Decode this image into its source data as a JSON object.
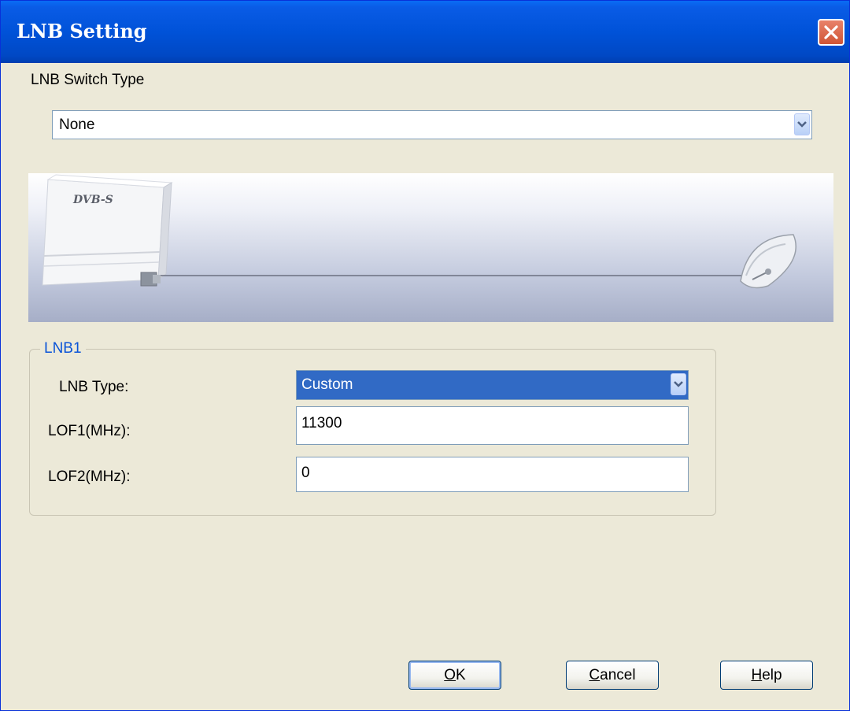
{
  "window": {
    "title": "LNB Setting",
    "close_icon": "close-icon"
  },
  "switch_type": {
    "label": "LNB Switch Type",
    "value": "None"
  },
  "banner": {
    "device_label": "DVB-S",
    "device_icon": "dvb-s-receiver-icon",
    "dish_icon": "satellite-dish-icon"
  },
  "lnb1": {
    "title": "LNB1",
    "type_label": "LNB Type:",
    "type_value": "Custom",
    "lof1_label": "LOF1(MHz):",
    "lof1_value": "11300",
    "lof2_label": "LOF2(MHz):",
    "lof2_value": "0"
  },
  "buttons": {
    "ok": {
      "mnemonic": "O",
      "rest": "K"
    },
    "cancel": {
      "mnemonic": "C",
      "rest": "ancel"
    },
    "help": {
      "mnemonic": "H",
      "rest": "elp"
    }
  },
  "colors": {
    "titlebar": "#0054e3",
    "face": "#ece9d8",
    "selection": "#316ac5",
    "group_title": "#0a54d8"
  }
}
